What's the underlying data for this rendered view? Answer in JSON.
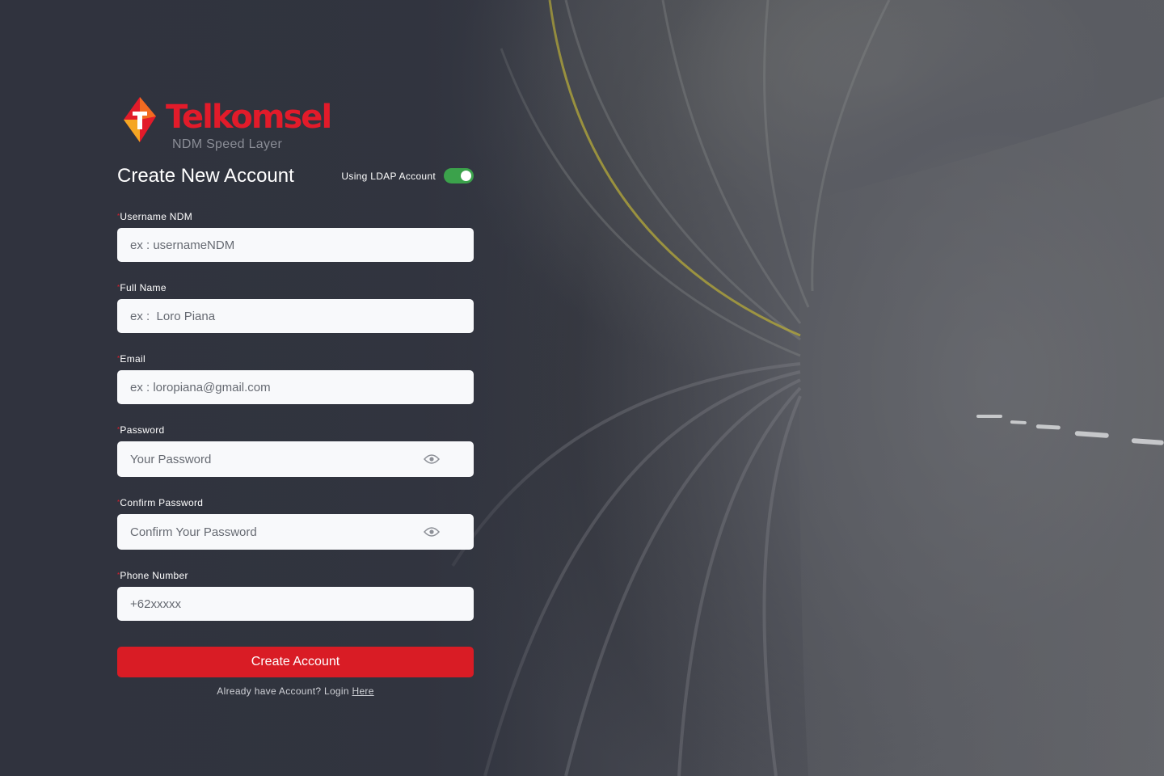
{
  "brand": {
    "name": "Telkomsel",
    "subtitle": "NDM Speed Layer",
    "color": "#e21b2a"
  },
  "page": {
    "title": "Create New Account"
  },
  "ldap": {
    "label": "Using LDAP Account",
    "enabled": true,
    "color": "#3ba24b"
  },
  "fields": {
    "username": {
      "label": "Username NDM",
      "placeholder": "ex : usernameNDM",
      "required_mark": "*"
    },
    "fullname": {
      "label": "Full Name",
      "placeholder": "ex :  Loro Piana",
      "required_mark": "*"
    },
    "email": {
      "label": "Email",
      "placeholder": "ex : loropiana@gmail.com",
      "required_mark": "*"
    },
    "password": {
      "label": "Password",
      "placeholder": "Your Password",
      "required_mark": "*",
      "icon": "eye-icon"
    },
    "confirm": {
      "label": "Confirm Password",
      "placeholder": "Confirm Your Password",
      "required_mark": "*",
      "icon": "eye-icon"
    },
    "phone": {
      "label": "Phone Number",
      "placeholder": "+62xxxxx",
      "required_mark": "*"
    }
  },
  "actions": {
    "create_label": "Create Account",
    "create_color": "#d91c25",
    "login_prompt": "Already have Account? Login ",
    "login_link": "Here"
  }
}
